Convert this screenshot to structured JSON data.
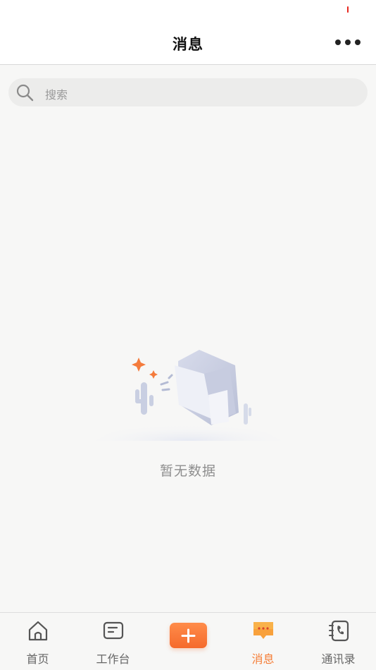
{
  "header": {
    "title": "消息"
  },
  "search": {
    "placeholder": "搜索"
  },
  "empty_state": {
    "text": "暂无数据"
  },
  "tab_bar": {
    "tabs": [
      {
        "label": "首页",
        "icon": "home-icon",
        "active": false
      },
      {
        "label": "工作台",
        "icon": "workbench-icon",
        "active": false
      },
      {
        "label": "消息",
        "icon": "message-icon",
        "active": true
      },
      {
        "label": "通讯录",
        "icon": "contacts-icon",
        "active": false
      }
    ],
    "add_icon": "plus-icon"
  },
  "colors": {
    "accent": "#f57c34",
    "background": "#f7f7f6",
    "status_mark": "#e8261e"
  }
}
